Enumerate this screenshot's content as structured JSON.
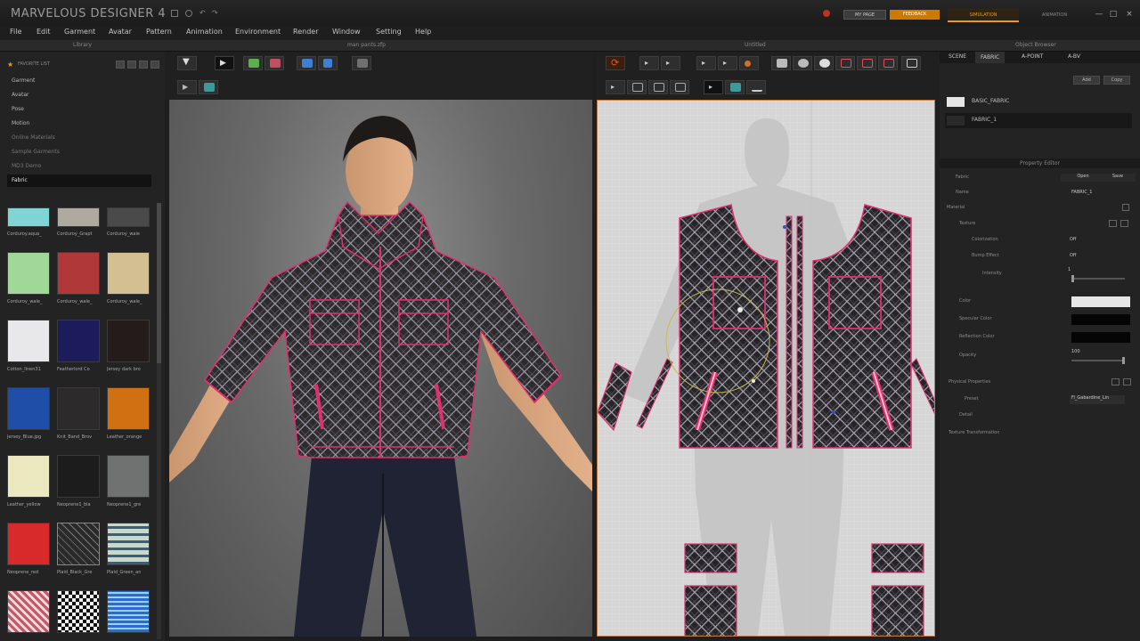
{
  "app": {
    "title": "MARVELOUS DESIGNER 4"
  },
  "titlebar": {
    "my_page": "MY PAGE",
    "feedback": "FEEDBACK",
    "simulation": "SIMULATION",
    "animation": "ANIMATION",
    "win_min": "—",
    "win_max": "□",
    "win_close": "×",
    "accent": "#e09a2a"
  },
  "menu": [
    "File",
    "Edit",
    "Garment",
    "Avatar",
    "Pattern",
    "Animation",
    "Environment",
    "Render",
    "Window",
    "Setting",
    "Help"
  ],
  "panels": {
    "library": "Library",
    "view3d": "man pants.zfp",
    "view2d": "Untitled",
    "object_browser": "Object Browser"
  },
  "library": {
    "favorite": "FAVORITE LIST",
    "items": [
      "Garment",
      "Avatar",
      "Pose",
      "Motion",
      "Online Materials",
      "Sample Garments",
      "MD3 Demo",
      "Fabric"
    ],
    "active_item": "Fabric",
    "swatches": [
      {
        "label": "Corduroy.aqua_",
        "color": "#7fd4d4"
      },
      {
        "label": "Corduroy_Grapt",
        "color": "#aeaaa0"
      },
      {
        "label": "Corduroy_wale",
        "color": "#4a4a4a"
      },
      {
        "label": "Corduroy_wale_",
        "color": "#a0d898"
      },
      {
        "label": "Corduroy_wale_",
        "color": "#b03838"
      },
      {
        "label": "Corduroy_wale_",
        "color": "#d4bf92"
      },
      {
        "label": "Cotton_linen31",
        "color": "#e8e8ea"
      },
      {
        "label": "Featherlord Co",
        "color": "#1c1c5a"
      },
      {
        "label": "Jersey dark bro",
        "color": "#231c1a"
      },
      {
        "label": "Jersey_Blue.jpg",
        "color": "#1e4ea8"
      },
      {
        "label": "Knit_Band_Brov",
        "color": "#2c2a2a"
      },
      {
        "label": "Leather_orange",
        "color": "#d07012"
      },
      {
        "label": "Leather_yellow",
        "color": "#ece8c0"
      },
      {
        "label": "Neoprene1_bla",
        "color": "#1c1c1c"
      },
      {
        "label": "Neoprene1_gre",
        "color": "#707272"
      },
      {
        "label": "Neoprene_red",
        "color": "#d82a2a"
      },
      {
        "label": "Plaid_Black_Gre",
        "color": "#2a2a2a"
      },
      {
        "label": "Plaid_Green_an",
        "color": "#a8c0b0"
      },
      {
        "label": "",
        "color": "#c05a68"
      },
      {
        "label": "",
        "color": "#eeeeee"
      },
      {
        "label": "",
        "color": "#2a6cd0"
      }
    ]
  },
  "object_browser": {
    "tabs": [
      "SCENE",
      "FABRIC",
      "A-POINT",
      "A-BV"
    ],
    "active_tab": "FABRIC",
    "btn_add": "Add",
    "btn_copy": "Copy",
    "fabrics": [
      {
        "name": "BASIC_FABRIC",
        "color": "#e6e6e6"
      },
      {
        "name": "FABRIC_1",
        "color": "#2a2a2a"
      }
    ]
  },
  "property_editor": {
    "title": "Property Editor",
    "fabric_label": "Fabric",
    "open": "Open",
    "save": "Save",
    "name_label": "Name",
    "name_value": "FABRIC_1",
    "material": "Material",
    "texture": "Texture",
    "colorization": "Colorization",
    "colorization_value": "Off",
    "bump": "Bump Effect",
    "bump_value": "Off",
    "intensity": "Intensity",
    "intensity_value": "1",
    "color": "Color",
    "color_value": "#e6e6e6",
    "specular": "Specular Color",
    "specular_value": "#050505",
    "reflection": "Reflection Color",
    "reflection_value": "#050505",
    "opacity": "Opacity",
    "opacity_value": "100",
    "physical": "Physical Properties",
    "preset_label": "Preset",
    "preset_value": "Fi_Gabardine_Lin",
    "detail": "Detail",
    "texture_transform": "Texture Transformation"
  }
}
